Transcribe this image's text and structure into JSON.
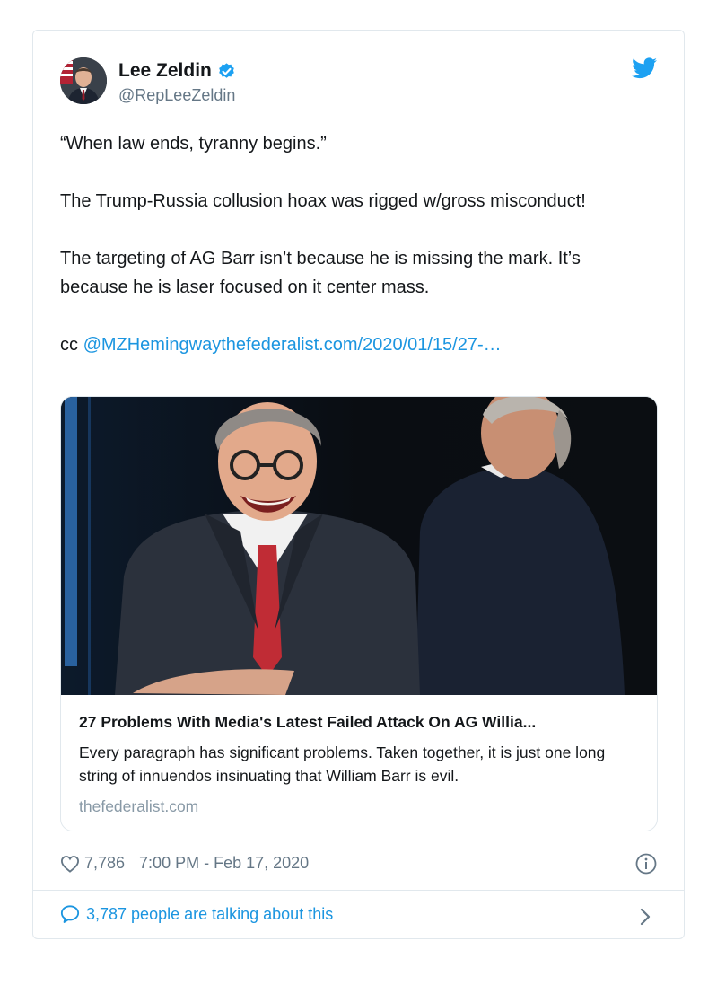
{
  "author": {
    "name": "Lee Zeldin",
    "handle": "@RepLeeZeldin"
  },
  "tweet": {
    "lines": [
      "“When law ends, tyranny begins.”",
      "The Trump-Russia collusion hoax was rigged w/gross misconduct!",
      "The targeting of AG Barr isn’t because he is missing the mark. It’s because he is laser focused on it center mass."
    ],
    "cc_prefix": "cc ",
    "mention_link": "@MZHemingwaythefederalist.com/2020/01/15/27-…"
  },
  "link_card": {
    "title": "27 Problems With Media's Latest Failed Attack On AG Willia...",
    "description": "Every paragraph has significant problems. Taken together, it is just one long string of innuendos insinuating that William Barr is evil.",
    "domain": "thefederalist.com"
  },
  "meta": {
    "likes": "7,786",
    "timestamp": "7:00 PM - Feb 17, 2020"
  },
  "footer": {
    "talking": "3,787 people are talking about this"
  },
  "colors": {
    "accent": "#1b95e0",
    "muted": "#657786",
    "border": "#e1e8ed"
  },
  "icons": [
    "verified-badge-icon",
    "twitter-bird-icon",
    "heart-icon",
    "info-icon",
    "speech-bubble-icon",
    "chevron-right-icon"
  ]
}
